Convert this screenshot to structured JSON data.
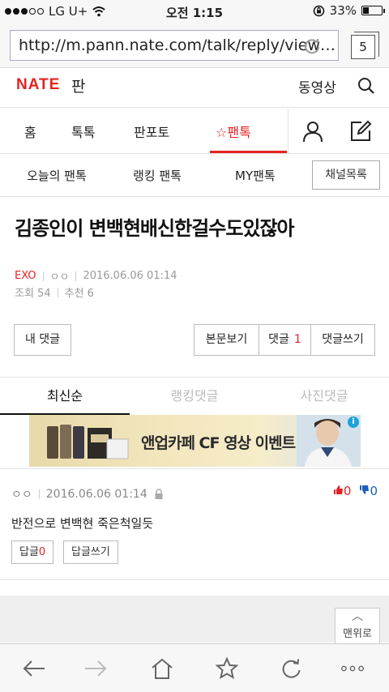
{
  "status_bar": {
    "carrier": "LG U+",
    "time": "오전 1:15",
    "battery": "33%",
    "battery_level": 0.33
  },
  "browser": {
    "url": "http://m.pann.nate.com/talk/reply/view…",
    "tab_count": "5"
  },
  "header": {
    "logo": "NATE",
    "section": "판",
    "video_link": "동영상"
  },
  "main_nav": [
    "홈",
    "톡톡",
    "판포토",
    "☆팬톡"
  ],
  "sub_nav": {
    "items": [
      "오늘의 팬톡",
      "랭킹 팬톡",
      "MY팬톡"
    ],
    "channel_button": "채널목록"
  },
  "article": {
    "title": "김종인이 변백현배신한걸수도있잖아",
    "category": "EXO",
    "author": "ㅇㅇ",
    "date": "2016.06.06 01:14",
    "views": "조회 54",
    "recommends": "추천 6"
  },
  "buttons": {
    "my_comments": "내 댓글",
    "view_original": "본문보기",
    "comments": "댓글",
    "comments_count": "1",
    "write_comment": "댓글쓰기"
  },
  "comment_tabs": [
    "최신순",
    "랭킹댓글",
    "사진댓글"
  ],
  "ad": {
    "text": "앤업카페 CF 영상 이벤트"
  },
  "comment": {
    "author": "ㅇㅇ",
    "date": "2016.06.06 01:14",
    "up": "0",
    "down": "0",
    "body": "반전으로 변백현 죽은척일듯",
    "reply_label": "답글",
    "reply_count": "0",
    "write_reply": "답글쓰기"
  },
  "scroll_top": "맨위로",
  "colors": {
    "accent": "#e52222",
    "vote_down": "#1f5fb8"
  }
}
